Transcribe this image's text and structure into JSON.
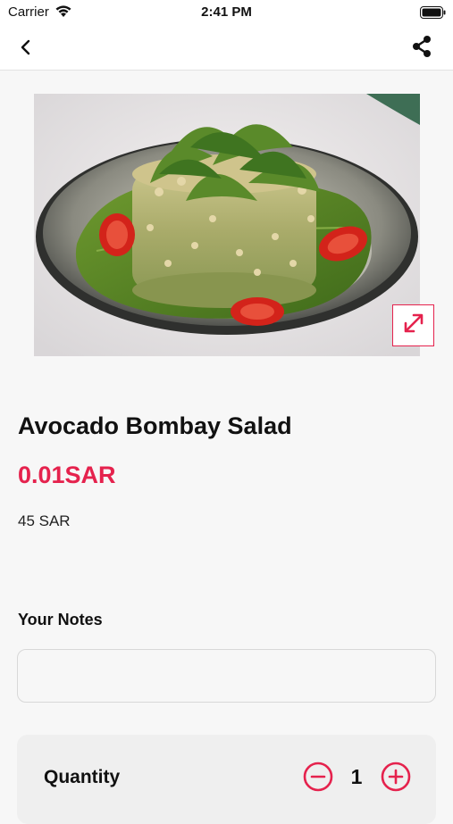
{
  "status_bar": {
    "carrier": "Carrier",
    "time": "2:41 PM",
    "icons": [
      "wifi-icon",
      "battery-icon"
    ]
  },
  "nav_bar": {
    "back_icon": "chevron-left-icon",
    "share_icon": "share-icon"
  },
  "product": {
    "title": "Avocado Bombay Salad",
    "sale_price": "0.01SAR",
    "original_price": "45 SAR",
    "expand_icon": "expand-arrows-icon"
  },
  "notes": {
    "label": "Your Notes",
    "value": "",
    "placeholder": ""
  },
  "quantity": {
    "label": "Quantity",
    "value": "1",
    "minus_icon": "minus-circle-icon",
    "plus_icon": "plus-circle-icon"
  },
  "colors": {
    "accent": "#e5224d",
    "background": "#f7f7f7",
    "card": "#efefef"
  }
}
